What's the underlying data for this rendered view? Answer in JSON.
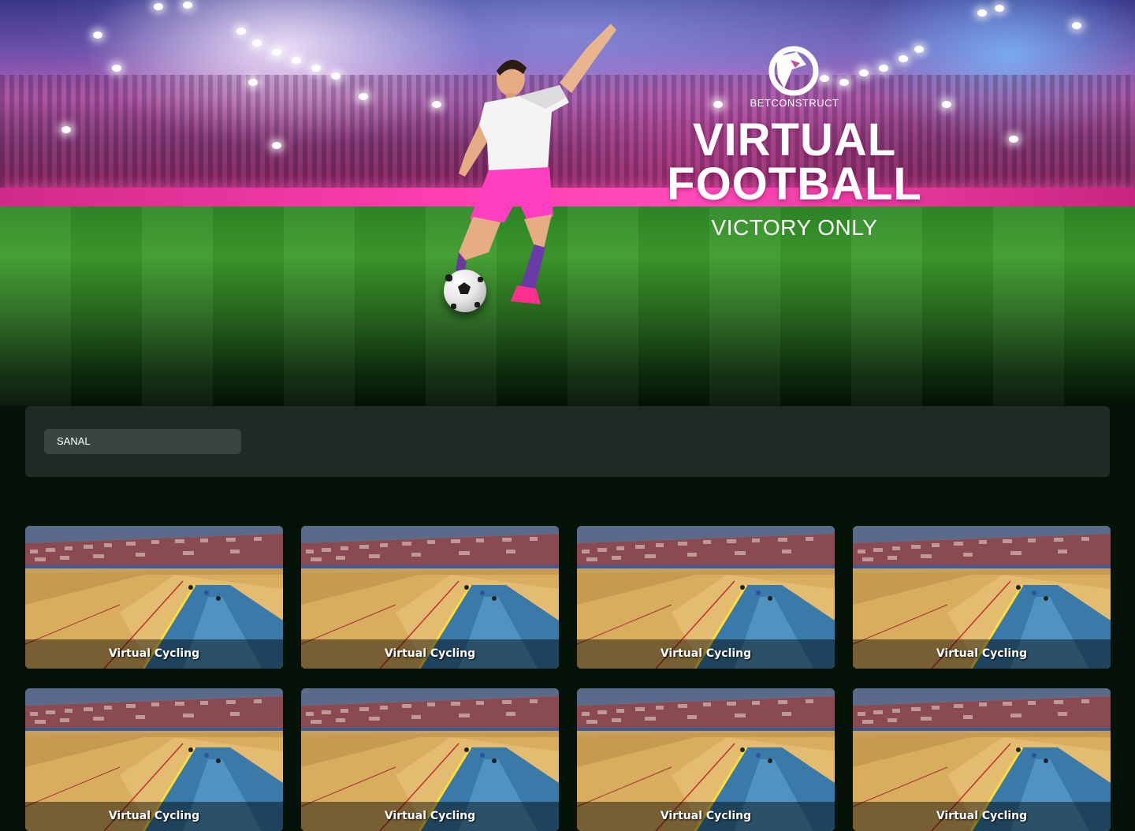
{
  "hero": {
    "brand_name": "BETCONSTRUCT",
    "title_line1": "VIRTUAL",
    "title_line2": "FOOTBALL",
    "subtitle": "VICTORY ONLY"
  },
  "filter": {
    "category": "SANAL"
  },
  "games": [
    {
      "title": "Virtual Cycling"
    },
    {
      "title": "Virtual Cycling"
    },
    {
      "title": "Virtual Cycling"
    },
    {
      "title": "Virtual Cycling"
    },
    {
      "title": "Virtual Cycling"
    },
    {
      "title": "Virtual Cycling"
    },
    {
      "title": "Virtual Cycling"
    },
    {
      "title": "Virtual Cycling"
    }
  ],
  "colors": {
    "page_background": "#041207",
    "filter_bar": "#1f2a24",
    "pill": "#3a4540",
    "accent_pink": "#ff3fb0"
  }
}
